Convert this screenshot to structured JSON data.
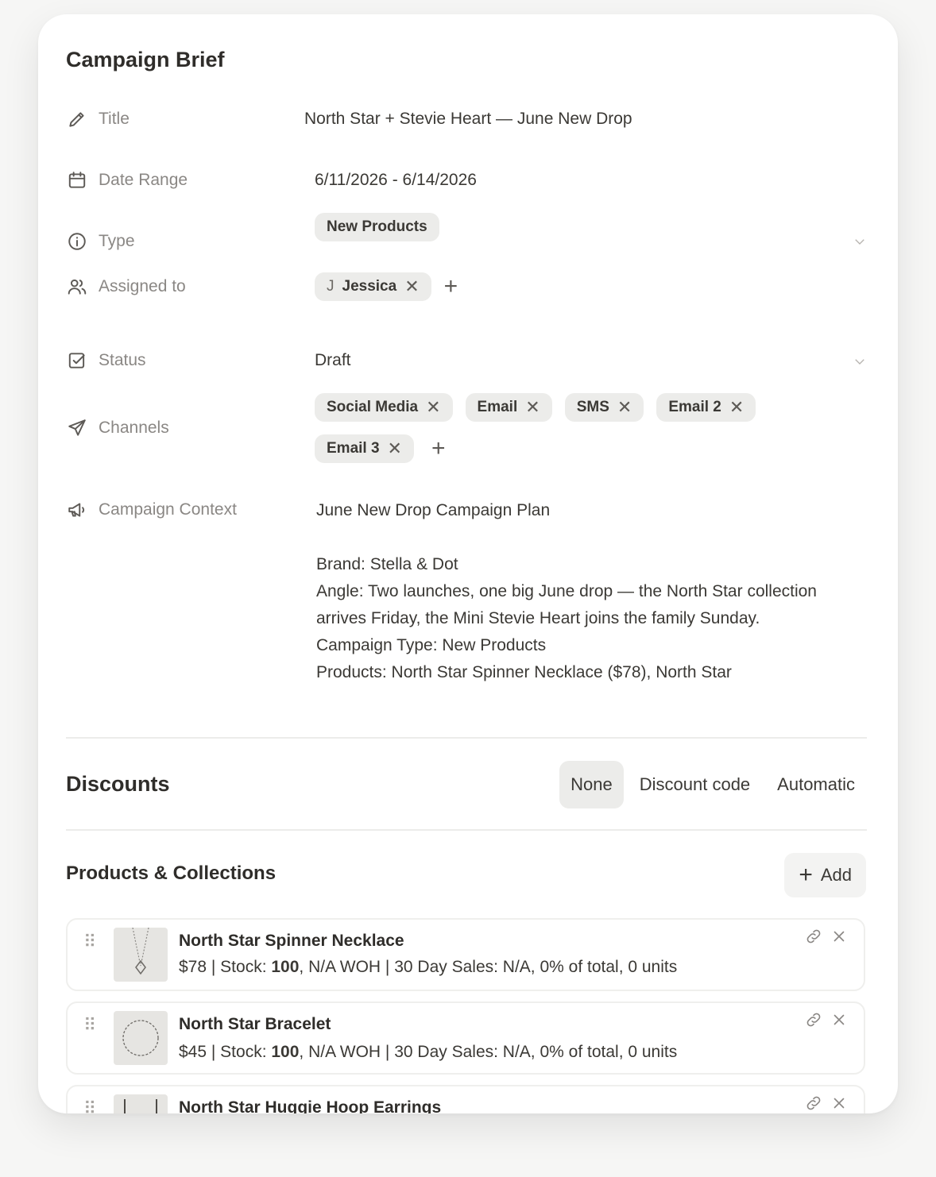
{
  "brief": {
    "title": "Campaign Brief",
    "fields": {
      "title": {
        "label": "Title",
        "value": "North Star + Stevie Heart — June New Drop"
      },
      "date_range": {
        "label": "Date Range",
        "value": "6/11/2026 - 6/14/2026"
      },
      "type": {
        "label": "Type",
        "value": "New Products"
      },
      "assigned": {
        "label": "Assigned to",
        "initial": "J",
        "name": "Jessica"
      },
      "status": {
        "label": "Status",
        "value": "Draft"
      },
      "channels": {
        "label": "Channels",
        "items": [
          "Social Media",
          "Email",
          "SMS",
          "Email 2",
          "Email 3"
        ]
      },
      "context": {
        "label": "Campaign Context",
        "value": "June New Drop Campaign Plan\n\nBrand: Stella & Dot\nAngle: Two launches, one big June drop — the North Star collection arrives Friday, the Mini Stevie Heart joins the family Sunday.\nCampaign Type: New Products\nProducts: North Star Spinner Necklace ($78), North Star"
      }
    }
  },
  "discounts": {
    "title": "Discounts",
    "options": [
      "None",
      "Discount code",
      "Automatic"
    ],
    "selected": "None"
  },
  "products": {
    "title": "Products & Collections",
    "add_label": "Add",
    "items": [
      {
        "name": "North Star Spinner Necklace",
        "price": "$78",
        "stock_label": "Stock:",
        "stock": "100",
        "rest": ", N/A WOH | 30 Day Sales: N/A, 0% of total, 0 units"
      },
      {
        "name": "North Star Bracelet",
        "price": "$45",
        "stock_label": "Stock:",
        "stock": "100",
        "rest": ", N/A WOH | 30 Day Sales: N/A, 0% of total, 0 units"
      },
      {
        "name": "North Star Huggie Hoop Earrings",
        "price": "",
        "stock_label": "",
        "stock": "",
        "rest": ""
      }
    ]
  }
}
